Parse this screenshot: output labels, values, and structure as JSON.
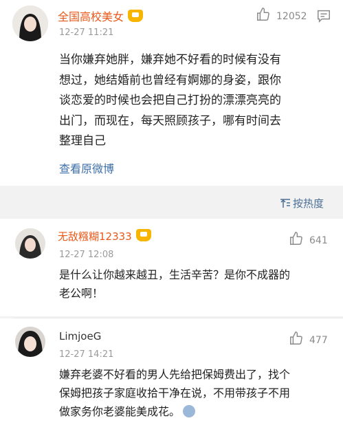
{
  "post": {
    "author": "全国高校美女",
    "time": "12-27 11:21",
    "likes": "12052",
    "lines": [
      "当你嫌弃她胖，嫌弃她不好看的时候有没有",
      "想过，她结婚前也曾经有婀娜的身姿，跟你",
      "谈恋爱的时候也会把自己打扮的漂漂亮亮的",
      "出门，而现在，每天照顾孩子，哪有时间去",
      "整理自己"
    ],
    "view_original": "查看原微博"
  },
  "sort": {
    "label": "按热度"
  },
  "comments": [
    {
      "author": "无敌糨糊12333",
      "time": "12-27 12:08",
      "likes": "641",
      "lines": [
        "是什么让你越来越丑，生活辛苦？是你不成器的",
        "老公啊！"
      ]
    },
    {
      "author": "LimjoeG",
      "time": "12-27 14:21",
      "likes": "477",
      "lines": [
        "嫌弃老婆不好看的男人先给把保姆费出了，找个",
        "保姆把孩子家庭收拾干净在说，不用带孩子不用",
        "做家务你老婆能美成花。"
      ]
    }
  ],
  "colors": {
    "name_orange": "#e8591a",
    "link_blue": "#3d6fa8"
  }
}
